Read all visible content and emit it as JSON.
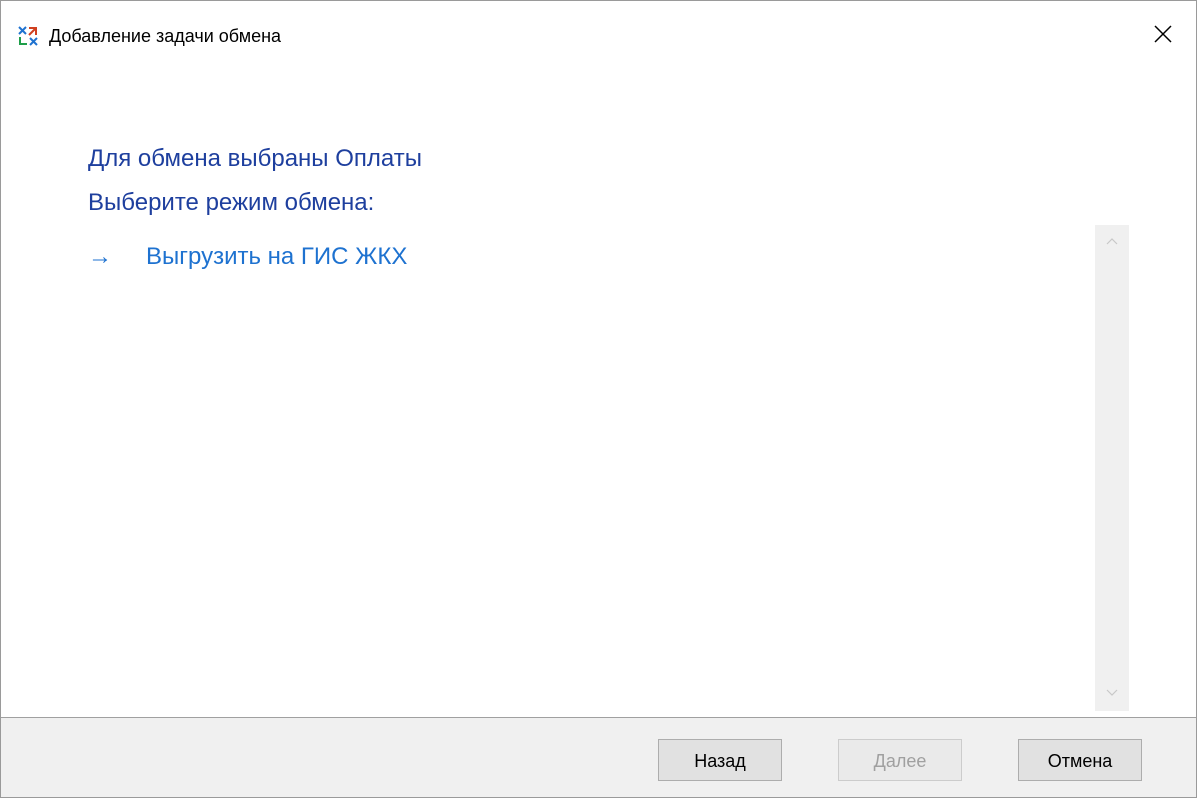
{
  "window": {
    "title": "Добавление задачи обмена",
    "icon": "exchange-app-icon",
    "close_icon": "close-icon"
  },
  "content": {
    "line1": "Для обмена выбраны Оплаты",
    "line2": "Выберите режим обмена:",
    "options": [
      {
        "arrow": "→",
        "label": "Выгрузить на ГИС ЖКХ"
      }
    ]
  },
  "scrollbar": {
    "up_icon": "scroll-up-icon",
    "down_icon": "scroll-down-icon"
  },
  "footer": {
    "back_label": "Назад",
    "next_label": "Далее",
    "cancel_label": "Отмена",
    "next_enabled": false
  },
  "colors": {
    "heading": "#1e3f9e",
    "link": "#1e72d0",
    "footer_bg": "#f0f0f0"
  }
}
